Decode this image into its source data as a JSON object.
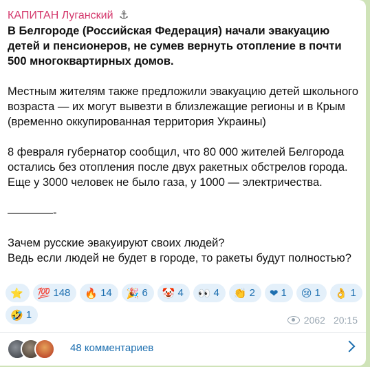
{
  "post": {
    "channel_name": "КАПИТАН Луганский",
    "channel_icon": "⚓",
    "headline": "В Белгороде (Российская Федерация) начали эвакуацию детей и пенсионеров, не сумев вернуть отопление в почти 500 многоквартирных домов.",
    "paragraph_1": "Местным жителям также предложили эвакуацию детей школьного возраста — их могут вывезти в близлежащие регионы и в Крым (временно оккупированная территория Украины)",
    "paragraph_2": "8 февраля губернатор сообщил, что 80 000 жителей Белгорода остались без отопления после двух ракетных обстрелов города. Еще у 3000 человек не было газа, у 1000 — электричества.",
    "separator": "————-",
    "question_1": "Зачем русские эвакуируют своих людей?",
    "question_2": "Ведь если людей не будет в городе, то ракеты будут полностью?"
  },
  "reactions": [
    {
      "emoji": "⭐",
      "count": "",
      "icon": "star-icon"
    },
    {
      "emoji": "💯",
      "count": "148",
      "icon": "hundred-points-icon"
    },
    {
      "emoji": "🔥",
      "count": "14",
      "icon": "fire-icon"
    },
    {
      "emoji": "🎉",
      "count": "6",
      "icon": "party-popper-icon"
    },
    {
      "emoji": "🤡",
      "count": "4",
      "icon": "clown-icon"
    },
    {
      "emoji": "👀",
      "count": "4",
      "icon": "eyes-icon"
    },
    {
      "emoji": "👏",
      "count": "2",
      "icon": "clapping-hands-icon"
    },
    {
      "emoji": "❤",
      "count": "1",
      "icon": "heart-icon"
    },
    {
      "emoji": "😢",
      "count": "1",
      "icon": "crying-face-icon"
    },
    {
      "emoji": "👌",
      "count": "1",
      "icon": "ok-hand-icon"
    },
    {
      "emoji": "🤣",
      "count": "1",
      "icon": "rofl-icon"
    }
  ],
  "meta": {
    "views": "2062",
    "time": "20:15"
  },
  "comments": {
    "label": "48 комментариев"
  },
  "colors": {
    "channel_name": "#d4386c",
    "accent": "#1d6fb0",
    "chip_bg": "#e4f0fa",
    "meta": "#9aa7b2"
  }
}
